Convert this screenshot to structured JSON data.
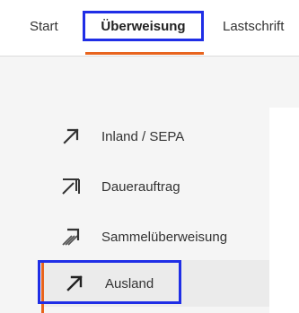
{
  "tabs": [
    {
      "label": "Start"
    },
    {
      "label": "Überweisung",
      "active": true
    },
    {
      "label": "Lastschrift"
    }
  ],
  "menu": {
    "items": [
      {
        "label": "Inland / SEPA",
        "icon": "arrow-up-right-icon"
      },
      {
        "label": "Dauerauftrag",
        "icon": "double-arrow-up-right-icon"
      },
      {
        "label": "Sammelüberweisung",
        "icon": "multi-arrow-up-right-icon"
      },
      {
        "label": "Ausland",
        "icon": "arrow-up-right-icon",
        "active": true
      }
    ]
  },
  "colors": {
    "accent": "#e8641e",
    "highlight_box": "#1f2ee6",
    "text": "#333333",
    "active_bg": "#ebebeb"
  }
}
